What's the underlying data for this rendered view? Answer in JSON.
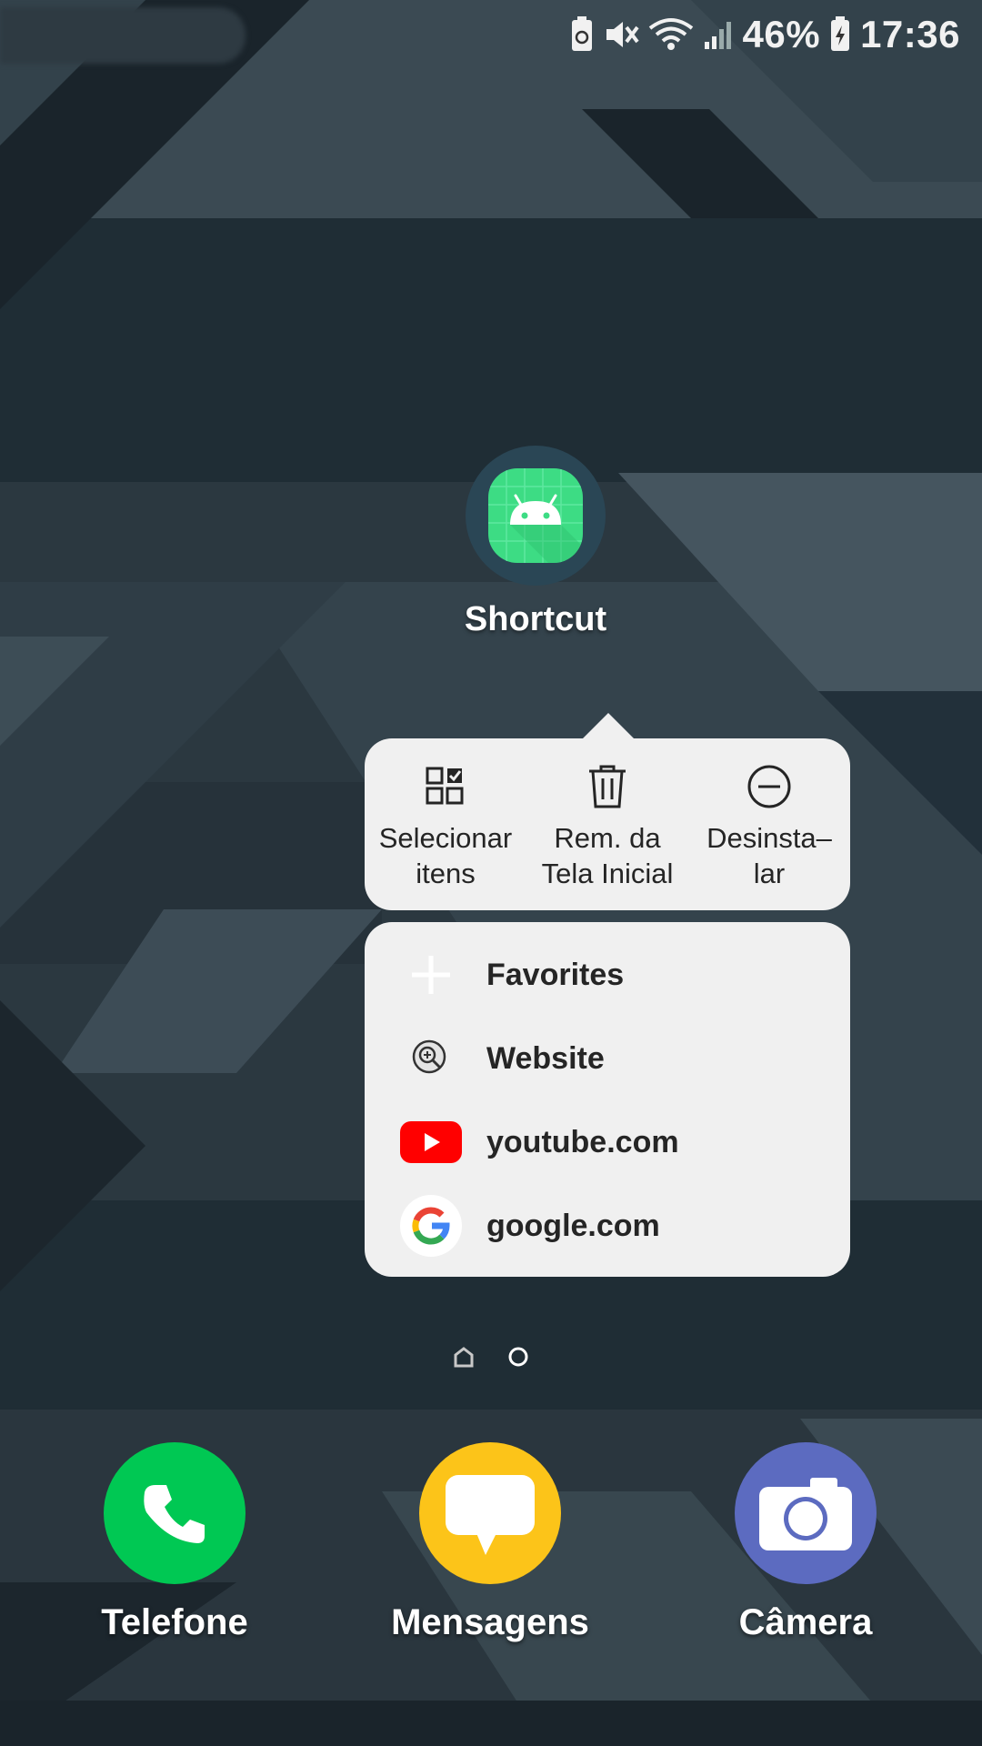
{
  "status_bar": {
    "battery_percent": "46%",
    "time": "17:36",
    "icons": [
      "battery-saver-icon",
      "vibrate-mute-icon",
      "wifi-icon",
      "signal-icon",
      "battery-charging-icon"
    ]
  },
  "app": {
    "label": "Shortcut",
    "icon": "android-app-icon",
    "icon_color": "#3ddc84"
  },
  "popup": {
    "actions": [
      {
        "label": "Selecionar\nitens",
        "icon": "select-items-icon"
      },
      {
        "label": "Rem. da\nTela Inicial",
        "icon": "trash-icon"
      },
      {
        "label": "Desinsta–\nlar",
        "icon": "uninstall-icon"
      }
    ],
    "shortcuts": [
      {
        "label": "Favorites",
        "icon": "plus-icon"
      },
      {
        "label": "Website",
        "icon": "zoom-in-icon"
      },
      {
        "label": "youtube.com",
        "icon": "youtube-icon"
      },
      {
        "label": "google.com",
        "icon": "google-icon"
      }
    ]
  },
  "page_indicator": {
    "pages": 2,
    "current_page": 2
  },
  "dock": [
    {
      "label": "Telefone",
      "icon": "phone-icon",
      "color": "#00c853"
    },
    {
      "label": "Mensagens",
      "icon": "messages-icon",
      "color": "#fcc419"
    },
    {
      "label": "Câmera",
      "icon": "camera-icon",
      "color": "#5c6bc0"
    }
  ]
}
